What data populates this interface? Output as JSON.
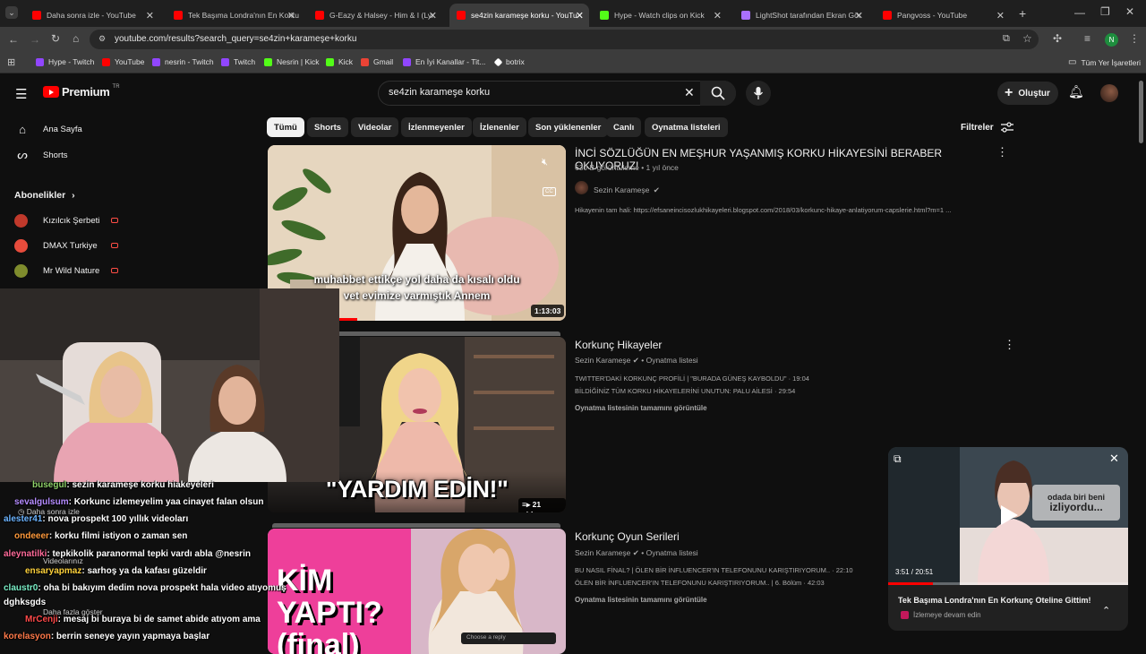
{
  "browser": {
    "tabs": [
      {
        "label": "Daha sonra izle - YouTube",
        "color": "#ff0000"
      },
      {
        "label": "Tek Başıma Londra'nın En Korku",
        "color": "#ff0000"
      },
      {
        "label": "G-Eazy & Halsey - Him & I (Lyr",
        "color": "#ff0000"
      },
      {
        "label": "se4zin karameşe korku - YouTu",
        "color": "#ff0000"
      },
      {
        "label": "Hype - Watch clips on Kick",
        "color": "#53fc18"
      },
      {
        "label": "LightShot tarafından Ekran Gör",
        "color": "#a970ff"
      },
      {
        "label": "Pangvoss - YouTube",
        "color": "#ff0000"
      }
    ],
    "url": "youtube.com/results?search_query=se4zin+karameşe+korku",
    "profile_initial": "N",
    "bookmarks": [
      {
        "label": "Hype - Twitch",
        "color": "#9146ff"
      },
      {
        "label": "YouTube",
        "color": "#ff0000"
      },
      {
        "label": "nesrin - Twitch",
        "color": "#9146ff"
      },
      {
        "label": "Twitch",
        "color": "#9146ff"
      },
      {
        "label": "Nesrin | Kick",
        "color": "#53fc18"
      },
      {
        "label": "Kick",
        "color": "#53fc18"
      },
      {
        "label": "Gmail",
        "color": "#ea4335"
      },
      {
        "label": "En İyi Kanallar - Tit...",
        "color": "#9146ff"
      },
      {
        "label": "botrix",
        "color": "#ffffff"
      }
    ],
    "all_bookmarks": "Tüm Yer İşaretleri"
  },
  "youtube": {
    "logo_text": "Premium",
    "region": "TR",
    "search_query": "se4zin karameşe korku",
    "create_label": "Oluştur",
    "filters_label": "Filtreler",
    "chips": [
      "Tümü",
      "Shorts",
      "Videolar",
      "İzlenmeyenler",
      "İzlenenler",
      "Son yüklenenler",
      "Canlı",
      "Oynatma listeleri"
    ],
    "sidebar": {
      "home": "Ana Sayfa",
      "shorts": "Shorts",
      "subs_header": "Abonelikler",
      "subs": [
        {
          "name": "Kızılcık Şerbeti",
          "color": "#c0392b"
        },
        {
          "name": "DMAX Turkiye",
          "color": "#e74c3c"
        },
        {
          "name": "Mr Wild Nature",
          "color": "#7f8c2d"
        }
      ],
      "watch_later": "Daha sonra izle",
      "your_videos": "Videolarınız",
      "show_more": "Daha fazla göster"
    },
    "results": [
      {
        "title": "İNCİ SÖZLÜĞÜN EN MEŞHUR YAŞANMIŞ KORKU HİKAYESİNİ BERABER OKUYORUZ!",
        "meta": "630 B görüntüleme • 1 yıl önce",
        "channel": "Sezin Karameşe",
        "desc": "Hikayenin tam hali: https://efsaneincisozlukhikayeleri.blogspot.com/2018/03/korkunc-hikaye-anlatiyorum-capslerie.html?m=1 ...",
        "duration": "1:13:03",
        "caption1": "muhabbet ettikçe yol daha da kısalı oldu",
        "caption2": "vet evimize varmıştık Annem",
        "cc": "CC"
      },
      {
        "title": "Korkunç Hikayeler",
        "channel": "Sezin Karameşe",
        "kind": "Oynatma listesi",
        "line1": "TWITTER'DAKİ KORKUNÇ PROFİLİ | \"BURADA GÜNEŞ KAYBOLDU\" · 19:04",
        "line2": "BİLDİĞİNİZ TÜM KORKU HİKAYELERİNİ UNUTUN: PALU AİLESİ · 29:54",
        "more": "Oynatma listesinin tamamını görüntüle",
        "count": "21 video",
        "thumb_text": "\"YARDIM EDİN!\""
      },
      {
        "title": "Korkunç Oyun Serileri",
        "channel": "Sezin Karameşe",
        "kind": "Oynatma listesi",
        "line1": "BU NASIL FİNAL? | ÖLEN BİR İNFLUENCER'IN TELEFONUNU KARIŞTIRIYORUM.. · 22:10",
        "line2": "ÖLEN BİR İNFLUENCER'IN TELEFONUNU KARIŞTIRIYORUM.. | 6. Bölüm · 42:03",
        "more": "Oynatma listesinin tamamını görüntüle",
        "thumb_text": "KİM YAPTI? (final)"
      }
    ],
    "miniplayer": {
      "title": "Tek Başıma Londra'nın En Korkunç Oteline Gittim!",
      "sub": "İzlemeye devam edin",
      "time": "3:51 / 20:51",
      "progress": 0.185,
      "overlay_line1": "odada biri beni",
      "overlay_line2": "izliyordu..."
    }
  },
  "chat": [
    {
      "user": "busegul",
      "msg": ": sezin karameşe korku hiakeyeleri",
      "color": "#8fd16a"
    },
    {
      "user": "sevalgulsum",
      "msg": ": Korkunc izlemeyelim yaa cinayet falan olsun",
      "color": "#b58cff"
    },
    {
      "user": "alester41",
      "msg": ": nova prospekt 100 yıllık videoları",
      "color": "#6cb4ff"
    },
    {
      "user": "ondeeer",
      "msg": ": korku filmi istiyon o zaman sen",
      "color": "#ff9a3c"
    },
    {
      "user": "aleynatilki",
      "msg": ": tepkikolik paranormal tepki vardı abla @nesrin",
      "color": "#ff6b9a"
    },
    {
      "user": "ensaryapmaz",
      "msg": ": sarhoş ya da kafası güzeldir",
      "color": "#ffd23c"
    },
    {
      "user": "claustr0",
      "msg": ": oha bi bakıyım dedim nova prospekt hala video atıyomuş",
      "color": "#7cf0c8"
    },
    {
      "user": "dghksgds",
      "msg": "",
      "color": "#ffffff"
    },
    {
      "user": "MrCenji",
      "msg": ": mesaj bi buraya bi de samet abide atıyom ama",
      "color": "#ff4a4a"
    },
    {
      "user": "korelasyon",
      "msg": ": berrin seneye yayın yapmaya başlar",
      "color": "#ff7a4a"
    }
  ],
  "chat_reply_placeholder": "Choose a reply"
}
